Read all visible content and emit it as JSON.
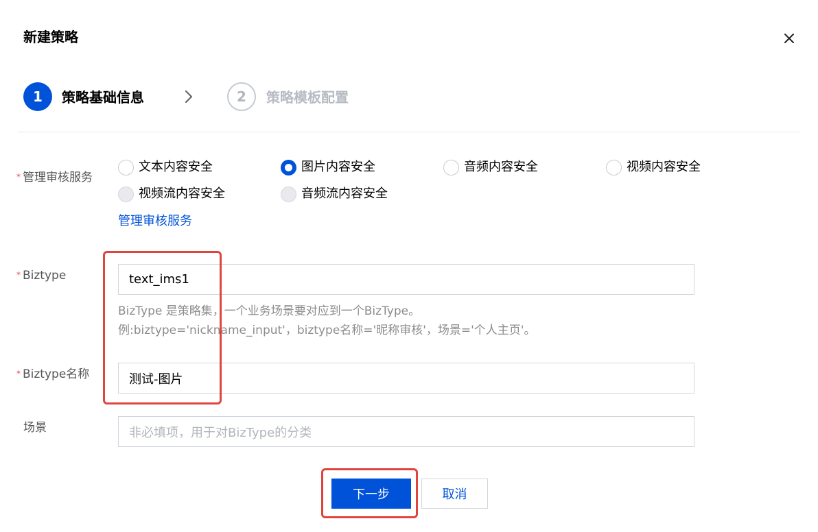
{
  "dialog": {
    "title": "新建策略",
    "close_icon": "close-icon"
  },
  "steps": [
    {
      "number": "1",
      "label": "策略基础信息",
      "state": "active"
    },
    {
      "number": "2",
      "label": "策略模板配置",
      "state": "inactive"
    }
  ],
  "form": {
    "service": {
      "label": "管理审核服务",
      "required_mark": "*",
      "options": [
        {
          "label": "文本内容安全",
          "state": "unchecked"
        },
        {
          "label": "图片内容安全",
          "state": "checked"
        },
        {
          "label": "音频内容安全",
          "state": "unchecked"
        },
        {
          "label": "视频内容安全",
          "state": "unchecked"
        },
        {
          "label": "视频流内容安全",
          "state": "disabled"
        },
        {
          "label": "音频流内容安全",
          "state": "disabled"
        }
      ],
      "manage_link": "管理审核服务"
    },
    "biztype": {
      "label": "Biztype",
      "required_mark": "*",
      "value": "text_ims1",
      "help_line1": "BizType 是策略集，一个业务场景要对应到一个BizType。",
      "help_line2": "例:biztype='nickname_input'，biztype名称='昵称审核'，场景='个人主页'。"
    },
    "biztype_name": {
      "label": "Biztype名称",
      "required_mark": "*",
      "value": "测试-图片"
    },
    "scene": {
      "label": "场景",
      "value": "",
      "placeholder": "非必填项，用于对BizType的分类"
    }
  },
  "buttons": {
    "next": "下一步",
    "cancel": "取消"
  },
  "colors": {
    "primary": "#0052d9",
    "required": "#e34d59",
    "highlight_box": "#e0443e"
  }
}
